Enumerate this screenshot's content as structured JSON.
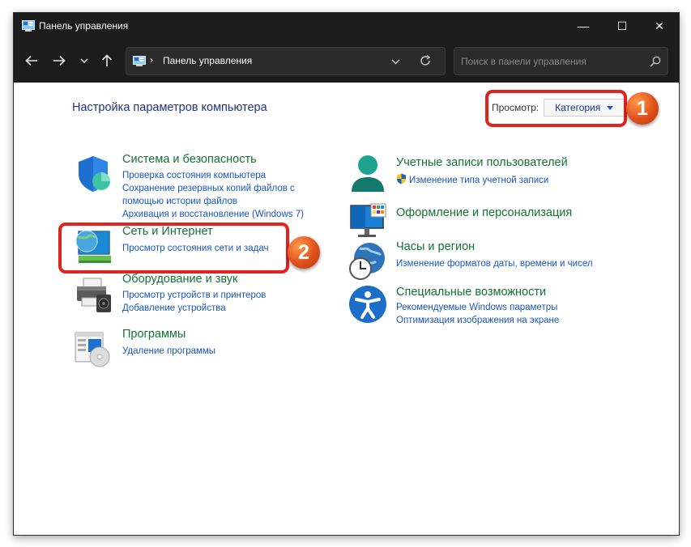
{
  "window": {
    "title": "Панель управления",
    "controls": {
      "minimize": "—",
      "maximize": "☐",
      "close": "✕"
    }
  },
  "addressbar": {
    "separator": "›",
    "path": "Панель управления",
    "search_placeholder": "Поиск в панели управления"
  },
  "content": {
    "heading": "Настройка параметров компьютера",
    "view_label": "Просмотр:",
    "view_value": "Категория"
  },
  "callouts": {
    "one": "1",
    "two": "2"
  },
  "categories": {
    "system": {
      "title": "Система и безопасность",
      "links": [
        "Проверка состояния компьютера",
        "Сохранение резервных копий файлов с",
        "помощью истории файлов",
        "Архивация и восстановление (Windows 7)"
      ]
    },
    "network": {
      "title": "Сеть и Интернет",
      "links": [
        "Просмотр состояния сети и задач"
      ]
    },
    "hardware": {
      "title": "Оборудование и звук",
      "links": [
        "Просмотр устройств и принтеров",
        "Добавление устройства"
      ]
    },
    "programs": {
      "title": "Программы",
      "links": [
        "Удаление программы"
      ]
    },
    "users": {
      "title": "Учетные записи пользователей",
      "links": [
        "Изменение типа учетной записи"
      ]
    },
    "appearance": {
      "title": "Оформление и персонализация",
      "links": []
    },
    "clock": {
      "title": "Часы и регион",
      "links": [
        "Изменение форматов даты, времени и чисел"
      ]
    },
    "access": {
      "title": "Специальные возможности",
      "links": [
        "Рекомендуемые Windows параметры",
        "Оптимизация изображения на экране"
      ]
    }
  },
  "colors": {
    "titlebar": "#1c1c1c",
    "heading": "#1e3287",
    "category_title": "#137333",
    "link": "#1a55c4",
    "callout": "#e0231e"
  },
  "icons": [
    "control-panel-icon",
    "back-arrow-icon",
    "forward-arrow-icon",
    "chevron-down-icon",
    "up-arrow-icon",
    "refresh-icon",
    "search-icon",
    "shield-icon",
    "network-globe-icon",
    "printer-icon",
    "programs-icon",
    "user-icon",
    "uac-shield-icon",
    "personalization-icon",
    "clock-globe-icon",
    "accessibility-icon"
  ]
}
